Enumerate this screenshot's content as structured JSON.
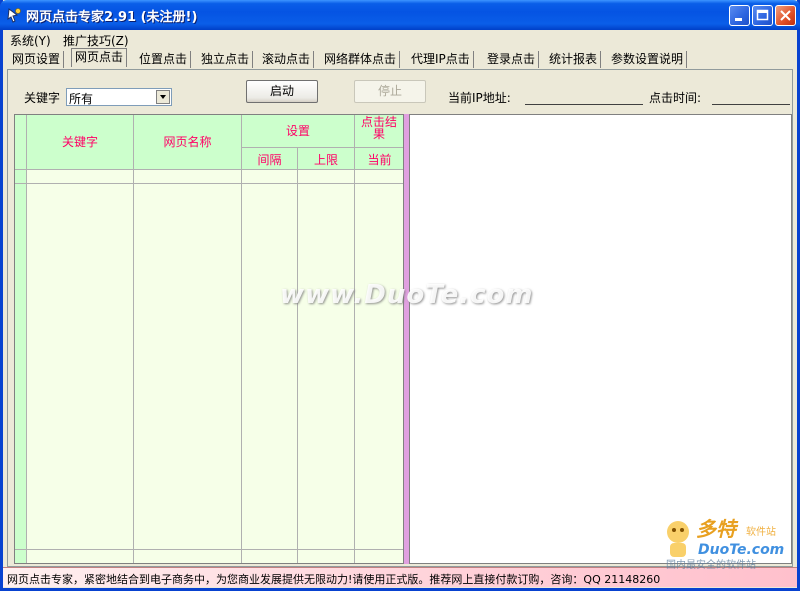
{
  "window": {
    "title": "网页点击专家2.91 (未注册!)"
  },
  "menu": [
    {
      "label": "系统(Y)"
    },
    {
      "label": "推广技巧(Z)"
    }
  ],
  "tabs": [
    {
      "label": "网页设置"
    },
    {
      "label": "网页点击",
      "active": true
    },
    {
      "label": "位置点击"
    },
    {
      "label": "独立点击"
    },
    {
      "label": "滚动点击"
    },
    {
      "label": "网络群体点击"
    },
    {
      "label": "代理IP点击"
    },
    {
      "label": "登录点击"
    },
    {
      "label": "统计报表"
    },
    {
      "label": "参数设置说明"
    }
  ],
  "controls": {
    "keyword_label": "关键字",
    "keyword_value": "所有",
    "start_button": "启动",
    "stop_button": "停止",
    "ip_label": "当前IP地址:",
    "time_label": "点击时间:"
  },
  "grid": {
    "col_keyword": "关键字",
    "col_pagename": "网页名称",
    "col_settings": "设置",
    "col_interval": "间隔",
    "col_limit": "上限",
    "col_result": "点击结果",
    "col_current": "当前"
  },
  "status": {
    "text": "网页点击专家，紧密地结合到电子商务中，为您商业发展提供无限动力!请使用正式版。推荐网上直接付款订购，咨询：QQ 21148260"
  },
  "watermark": {
    "text": "www.DuoTe.com"
  },
  "colors": {
    "title_blue": "#0554e3",
    "header_green": "#ccffcc",
    "header_text": "#ff0066",
    "splitter": "#e0a0e0"
  }
}
